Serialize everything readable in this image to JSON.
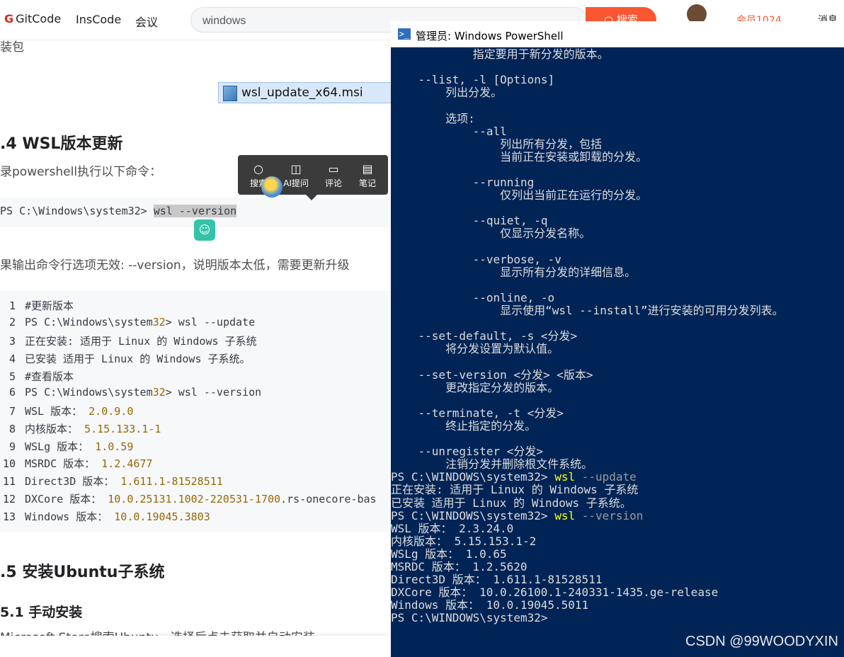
{
  "nav": {
    "logo_text": "GitCode",
    "links": [
      "InsCode",
      "会议"
    ],
    "search_value": "windows",
    "search_button": "搜索",
    "vip_text": "会员1024",
    "messages": "消息"
  },
  "article": {
    "intro_fragment": "装包",
    "msi_file": "wsl_update_x64.msi",
    "section_4_title": ".4 WSL版本更新",
    "section_4_text": "录powershell执行以下命令：",
    "single_cmd_prompt": "PS C:\\Windows\\system32> ",
    "single_cmd_selected": "wsl --version",
    "result_text": "果输出命令行选项无效: --version，说明版本太低，需要更新升级",
    "code_lines": [
      {
        "n": "1",
        "t": "#更新版本"
      },
      {
        "n": "2",
        "t": "PS C:\\Windows\\system",
        "num": "32",
        "rest": "> wsl --update"
      },
      {
        "n": "3",
        "t": "正在安装: 适用于 Linux 的 Windows 子系统"
      },
      {
        "n": "4",
        "t": "已安装 适用于 Linux 的 Windows 子系统。"
      },
      {
        "n": "5",
        "t": "#查看版本"
      },
      {
        "n": "6",
        "t": "PS C:\\Windows\\system",
        "num": "32",
        "rest": "> wsl --version"
      },
      {
        "n": "7",
        "t": "WSL 版本： ",
        "num": "2.0.9.0",
        "rest": ""
      },
      {
        "n": "8",
        "t": "内核版本： ",
        "num": "5.15.133.1-1",
        "rest": ""
      },
      {
        "n": "9",
        "t": "WSLg 版本： ",
        "num": "1.0.59",
        "rest": ""
      },
      {
        "n": "10",
        "t": "MSRDC 版本： ",
        "num": "1.2.4677",
        "rest": ""
      },
      {
        "n": "11",
        "t": "Direct3D 版本： ",
        "num": "1.611.1-81528511",
        "rest": ""
      },
      {
        "n": "12",
        "t": "DXCore 版本： ",
        "num": "10.0.25131.1002-220531-1700",
        "rest": ".rs-onecore-bas"
      },
      {
        "n": "13",
        "t": "Windows 版本： ",
        "num": "10.0.19045.3803",
        "rest": ""
      }
    ],
    "section_5_title": ".5 安装Ubuntu子系统",
    "section_51_title": "5.1 手动安装",
    "section_51_text": "Microsoft Store搜索Ubuntu，选择后点击获取并自动安装"
  },
  "toolbar": {
    "items": [
      {
        "icon": "search-icon",
        "label": "搜索"
      },
      {
        "icon": "ai-icon",
        "label": "AI提问"
      },
      {
        "icon": "comment-icon",
        "label": "评论"
      },
      {
        "icon": "note-icon",
        "label": "笔记"
      }
    ]
  },
  "powershell": {
    "title": "管理员: Windows PowerShell",
    "lines": [
      {
        "t": "            指定要用于新分发的版本。"
      },
      {
        "t": ""
      },
      {
        "t": "    --list, -l [Options]"
      },
      {
        "t": "        列出分发。"
      },
      {
        "t": ""
      },
      {
        "t": "        选项:"
      },
      {
        "t": "            --all"
      },
      {
        "t": "                列出所有分发，包括"
      },
      {
        "t": "                当前正在安装或卸载的分发。"
      },
      {
        "t": ""
      },
      {
        "t": "            --running"
      },
      {
        "t": "                仅列出当前正在运行的分发。"
      },
      {
        "t": ""
      },
      {
        "t": "            --quiet, -q"
      },
      {
        "t": "                仅显示分发名称。"
      },
      {
        "t": ""
      },
      {
        "t": "            --verbose, -v"
      },
      {
        "t": "                显示所有分发的详细信息。"
      },
      {
        "t": ""
      },
      {
        "t": "            --online, -o"
      },
      {
        "t": "                显示使用“wsl --install”进行安装的可用分发列表。"
      },
      {
        "t": ""
      },
      {
        "t": "    --set-default, -s <分发>"
      },
      {
        "t": "        将分发设置为默认值。"
      },
      {
        "t": ""
      },
      {
        "t": "    --set-version <分发> <版本>"
      },
      {
        "t": "        更改指定分发的版本。"
      },
      {
        "t": ""
      },
      {
        "t": "    --terminate, -t <分发>"
      },
      {
        "t": "        终止指定的分发。"
      },
      {
        "t": ""
      },
      {
        "t": "    --unregister <分发>"
      },
      {
        "t": "        注销分发并删除根文件系统。"
      },
      {
        "t": "PS C:\\WINDOWS\\system32> ",
        "cmd": "wsl",
        "arg": " --update"
      },
      {
        "t": "正在安装: 适用于 Linux 的 Windows 子系统"
      },
      {
        "t": "已安装 适用于 Linux 的 Windows 子系统。"
      },
      {
        "t": "PS C:\\WINDOWS\\system32> ",
        "cmd": "wsl",
        "arg": " --version"
      },
      {
        "t": "WSL 版本： 2.3.24.0"
      },
      {
        "t": "内核版本： 5.15.153.1-2"
      },
      {
        "t": "WSLg 版本： 1.0.65"
      },
      {
        "t": "MSRDC 版本： 1.2.5620"
      },
      {
        "t": "Direct3D 版本： 1.611.1-81528511"
      },
      {
        "t": "DXCore 版本： 10.0.26100.1-240331-1435.ge-release"
      },
      {
        "t": "Windows 版本： 10.0.19045.5011"
      },
      {
        "t": "PS C:\\WINDOWS\\system32>"
      }
    ]
  },
  "watermark": "CSDN @99WOODYXIN"
}
